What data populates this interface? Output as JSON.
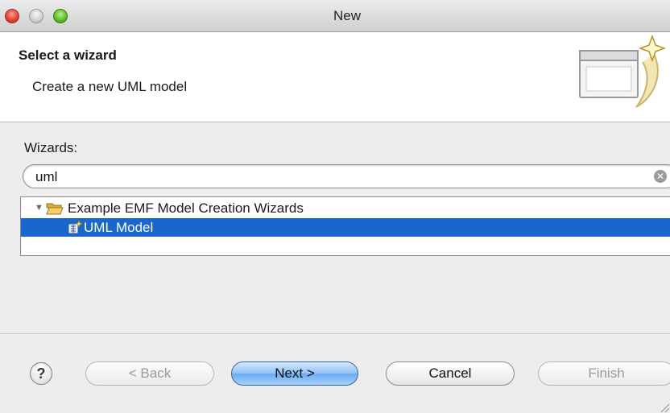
{
  "window": {
    "title": "New"
  },
  "banner": {
    "title": "Select a wizard",
    "description": "Create a new UML model",
    "icon": "new-wizard-icon"
  },
  "main": {
    "wizards_label": "Wizards:",
    "filter": {
      "value": "uml",
      "clear_icon": "clear-search-icon"
    },
    "tree": {
      "items": [
        {
          "label": "Example EMF Model Creation Wizards",
          "icon": "folder-open-icon",
          "expanded": true,
          "selected": false
        },
        {
          "label": "UML Model",
          "icon": "uml-model-icon",
          "selected": true
        }
      ]
    }
  },
  "footer": {
    "help_label": "?",
    "back_label": "< Back",
    "next_label": "Next >",
    "cancel_label": "Cancel",
    "finish_label": "Finish"
  },
  "colors": {
    "selection": "#1966cf",
    "dialog_bg": "#ededed",
    "default_button": "#8fc0f4",
    "close_button": "#e0443a",
    "zoom_button": "#5cc02c"
  }
}
